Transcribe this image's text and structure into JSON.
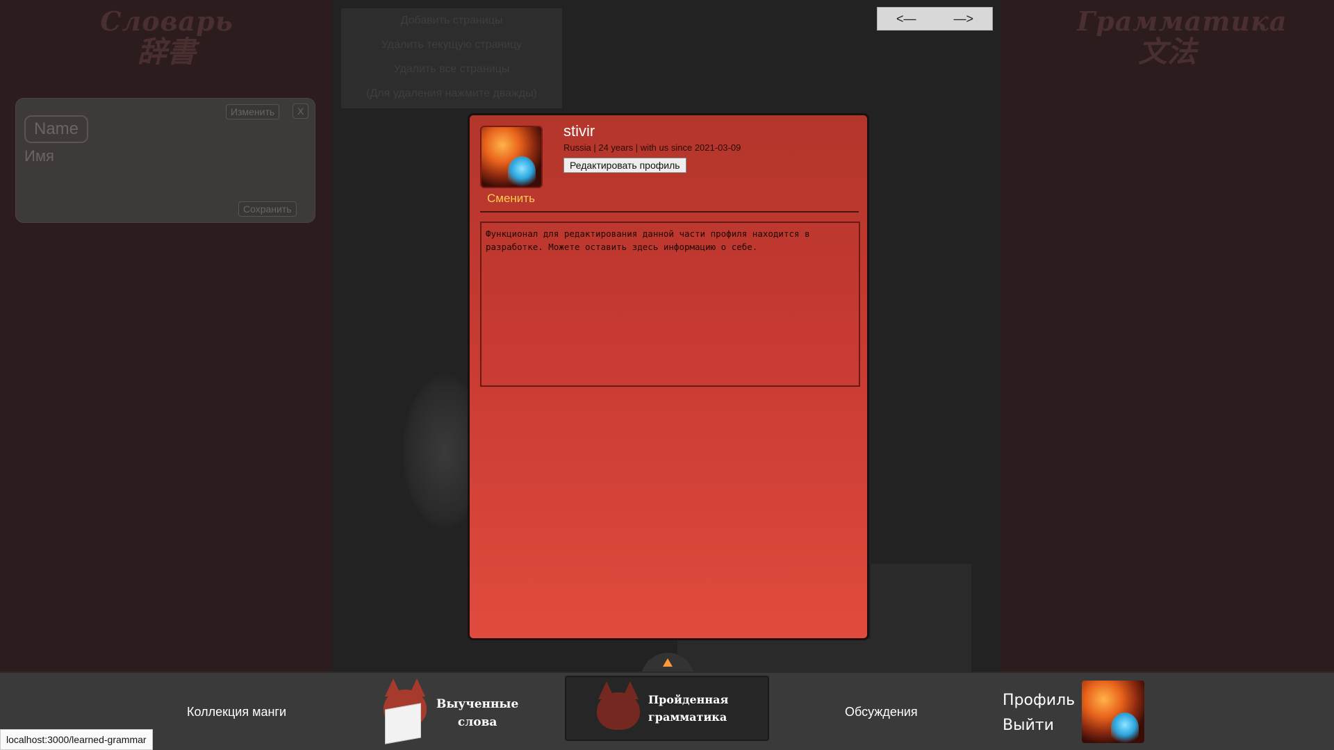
{
  "left_panel": {
    "title_line1": "Словарь",
    "title_line2": "辞書",
    "card": {
      "name": "Name",
      "name_translation": "Имя",
      "edit_label": "Изменить",
      "close_label": "X",
      "save_label": "Сохранить"
    }
  },
  "right_panel": {
    "title_line1": "Грамматика",
    "title_line2": "文法"
  },
  "page_menu": {
    "add_pages": "Добавить страницы",
    "delete_current": "Удалить текущую страницу",
    "delete_all": "Удалить все страницы",
    "hint": "(Для удаления нажмите дважды)"
  },
  "nav": {
    "prev": "<—",
    "next": "—>"
  },
  "profile_modal": {
    "username": "stivir",
    "meta": "Russia | 24 years | with us since 2021-03-09",
    "edit_profile_label": "Редактировать профиль",
    "change_avatar_label": "Сменить",
    "about_text": "Функционал для редактирования данной части профиля находится в разработке. Можете оставить здесь информацию о себе."
  },
  "footer": {
    "collection_label": "Коллекция манги",
    "learned_words_line1": "Выученные",
    "learned_words_line2": "слова",
    "learned_grammar_line1": "Пройденная",
    "learned_grammar_line2": "грамматика",
    "discussions_label": "Обсуждения",
    "profile_label": "Профиль",
    "logout_label": "Выйти"
  },
  "status_bar": {
    "url": "localhost:3000/learned-grammar"
  },
  "colors": {
    "modal_top": "#b3362b",
    "modal_bottom": "#e04b3e",
    "accent_link": "#ffcc4d",
    "side_bg": "#2d1c1e"
  }
}
